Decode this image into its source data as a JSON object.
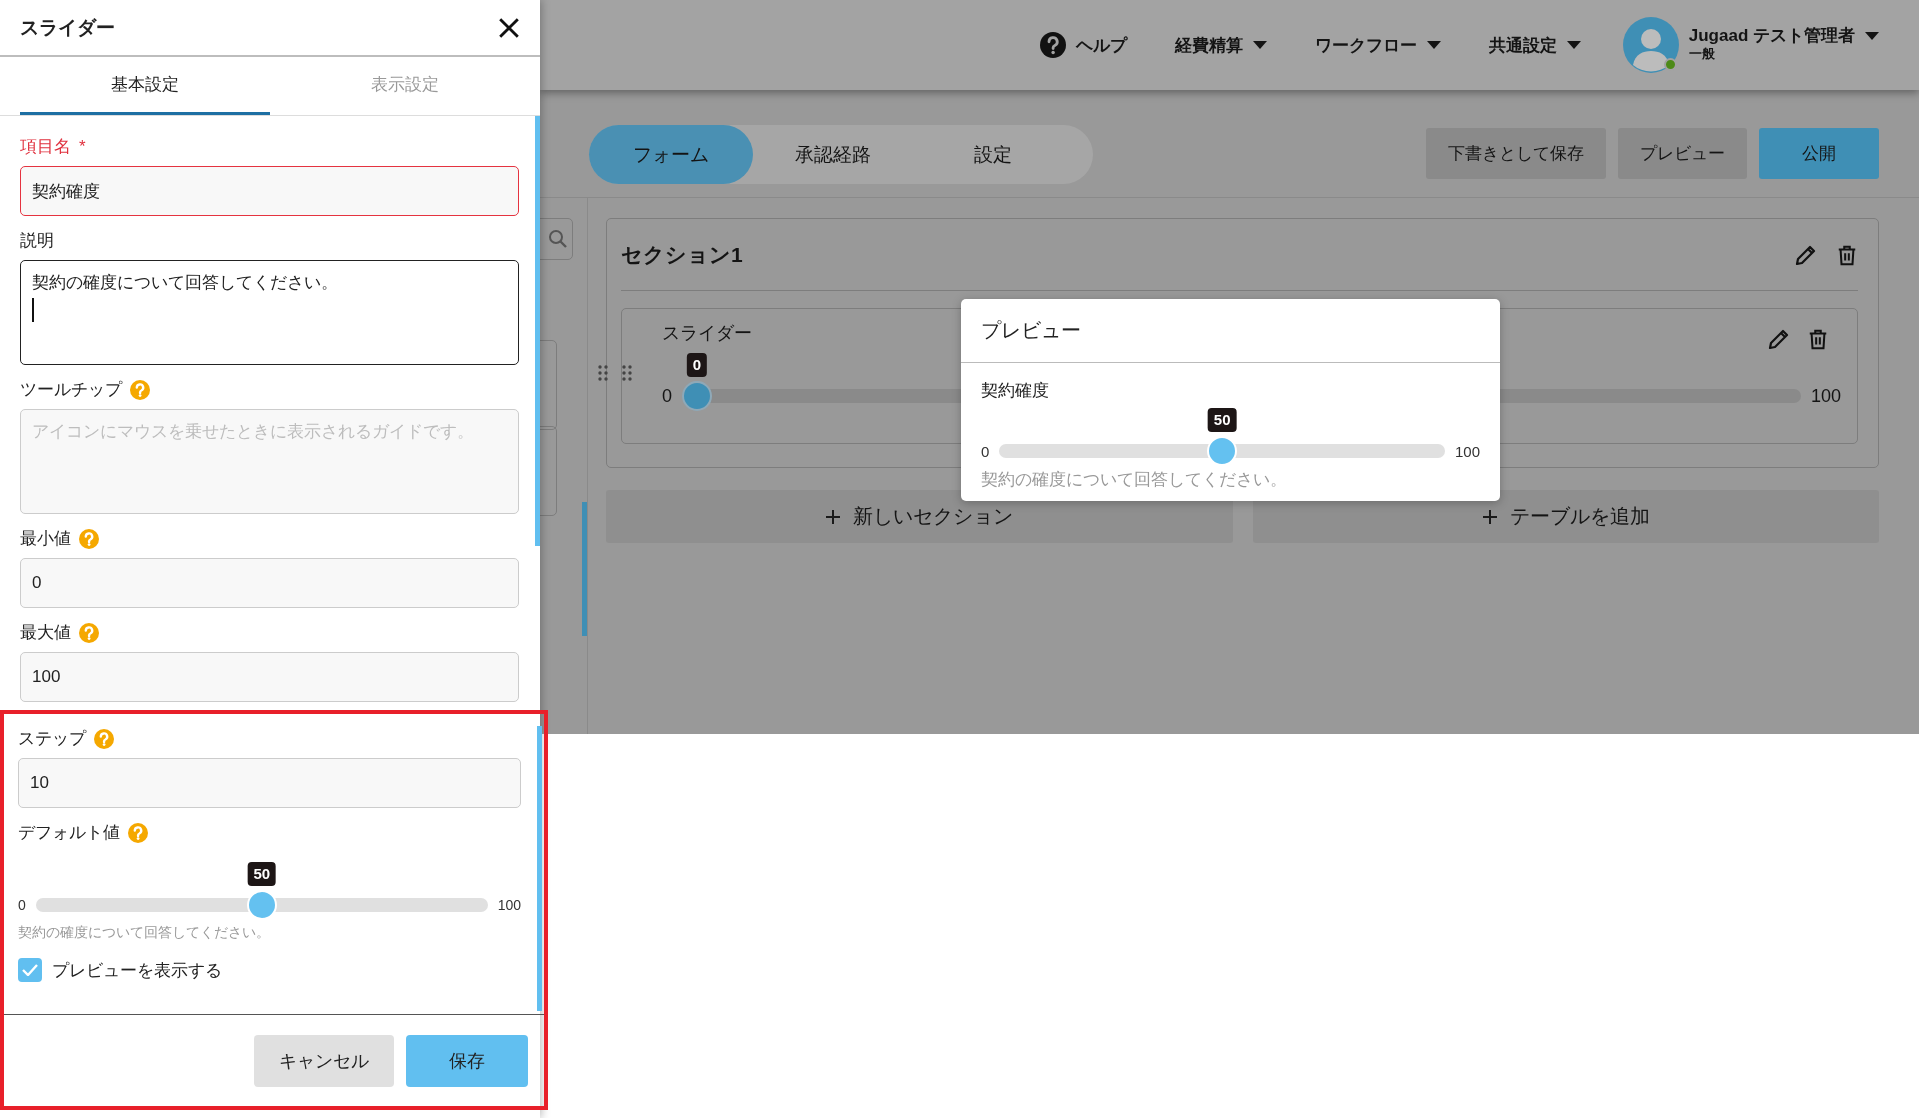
{
  "panel": {
    "title": "スライダー",
    "tabs": [
      {
        "label": "基本設定",
        "selected": true
      },
      {
        "label": "表示設定",
        "selected": false
      }
    ],
    "fields": [
      {
        "kind": "input",
        "label": "項目名",
        "required_mark": "*",
        "invalid": true,
        "value": "契約確度"
      },
      {
        "kind": "textarea",
        "label": "説明",
        "focused": true,
        "value": "契約の確度について回答してください。"
      },
      {
        "kind": "textarea",
        "label": "ツールチップ",
        "help": true,
        "placeholder": "アイコンにマウスを乗せたときに表示されるガイドです。"
      },
      {
        "kind": "input",
        "label": "最小値",
        "help": true,
        "value": "0"
      },
      {
        "kind": "input",
        "label": "最大値",
        "help": true,
        "value": "100"
      }
    ],
    "highlighted": {
      "fields": [
        {
          "kind": "input",
          "label": "ステップ",
          "help": true,
          "value": "10"
        },
        {
          "kind": "slider",
          "label": "デフォルト値",
          "help": true,
          "min": "0",
          "max": "100",
          "value": "50",
          "level": 0.5,
          "description": "契約の確度について回答してください。"
        },
        {
          "kind": "checkbox",
          "label": "プレビューを表示する",
          "checked": true
        }
      ],
      "buttons": [
        {
          "label": "キャンセル",
          "kind": "secondary"
        },
        {
          "label": "保存",
          "kind": "primary"
        }
      ]
    }
  },
  "app": {
    "nav": [
      {
        "kind": "help",
        "label": "ヘルプ"
      },
      {
        "kind": "menu",
        "label": "経費精算"
      },
      {
        "kind": "menu",
        "label": "ワークフロー"
      },
      {
        "kind": "menu",
        "label": "共通設定"
      }
    ],
    "user": {
      "name": "Jugaad テスト管理者",
      "role": "一般",
      "online": true
    },
    "tabs": [
      {
        "label": "フォーム",
        "selected": true
      },
      {
        "label": "承認経路",
        "selected": false
      },
      {
        "label": "設定",
        "selected": false
      }
    ],
    "actions": [
      {
        "label": "下書きとして保存",
        "kind": "secondary"
      },
      {
        "label": "プレビュー",
        "kind": "secondary"
      },
      {
        "label": "公開",
        "kind": "primary"
      }
    ],
    "section": {
      "title": "セクション1",
      "field": {
        "label": "スライダー",
        "min": "0",
        "max": "100",
        "value": "0",
        "level": 0
      }
    },
    "add_buttons": [
      {
        "label": "新しいセクション"
      },
      {
        "label": "テーブルを追加"
      }
    ]
  },
  "preview": {
    "title": "プレビュー",
    "label": "契約確度",
    "min": "0",
    "max": "100",
    "value": "50",
    "level": 0.5,
    "description": "契約の確度について回答してください。"
  }
}
